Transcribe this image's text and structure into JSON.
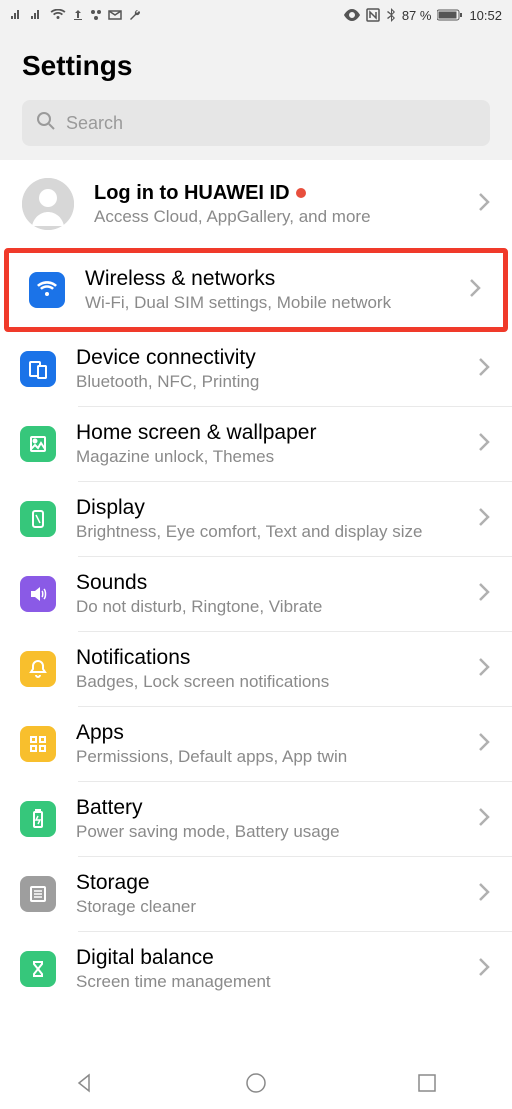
{
  "status": {
    "battery_pct": "87 %",
    "time": "10:52"
  },
  "header": {
    "title": "Settings"
  },
  "search": {
    "placeholder": "Search"
  },
  "profile": {
    "title": "Log in to HUAWEI ID",
    "subtitle": "Access Cloud, AppGallery, and more"
  },
  "items": [
    {
      "title": "Wireless & networks",
      "subtitle": "Wi-Fi, Dual SIM settings, Mobile network"
    },
    {
      "title": "Device connectivity",
      "subtitle": "Bluetooth, NFC, Printing"
    },
    {
      "title": "Home screen & wallpaper",
      "subtitle": "Magazine unlock, Themes"
    },
    {
      "title": "Display",
      "subtitle": "Brightness, Eye comfort, Text and display size"
    },
    {
      "title": "Sounds",
      "subtitle": "Do not disturb, Ringtone, Vibrate"
    },
    {
      "title": "Notifications",
      "subtitle": "Badges, Lock screen notifications"
    },
    {
      "title": "Apps",
      "subtitle": "Permissions, Default apps, App twin"
    },
    {
      "title": "Battery",
      "subtitle": "Power saving mode, Battery usage"
    },
    {
      "title": "Storage",
      "subtitle": "Storage cleaner"
    },
    {
      "title": "Digital balance",
      "subtitle": "Screen time management"
    }
  ]
}
